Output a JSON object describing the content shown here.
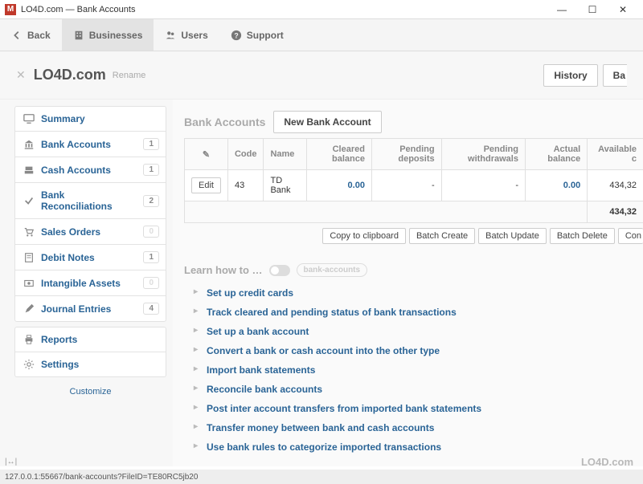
{
  "window": {
    "app_icon_letter": "M",
    "title": "LO4D.com — Bank Accounts"
  },
  "win_controls": {
    "min": "—",
    "max": "☐",
    "close": "✕"
  },
  "topnav": {
    "back": "Back",
    "businesses": "Businesses",
    "users": "Users",
    "support": "Support"
  },
  "business": {
    "name": "LO4D.com",
    "rename": "Rename",
    "history_btn": "History",
    "back_btn_partial": "Ba"
  },
  "sidebar": {
    "items": [
      {
        "label": "Summary",
        "icon": "monitor",
        "badge": null
      },
      {
        "label": "Bank Accounts",
        "icon": "bank",
        "badge": "1"
      },
      {
        "label": "Cash Accounts",
        "icon": "cash",
        "badge": "1"
      },
      {
        "label": "Bank Reconciliations",
        "icon": "check",
        "badge": "2"
      },
      {
        "label": "Sales Orders",
        "icon": "cart",
        "badge": "0"
      },
      {
        "label": "Debit Notes",
        "icon": "note",
        "badge": "1"
      },
      {
        "label": "Intangible Assets",
        "icon": "asset",
        "badge": "0"
      },
      {
        "label": "Journal Entries",
        "icon": "pen",
        "badge": "4"
      }
    ],
    "reports": "Reports",
    "settings": "Settings",
    "customize": "Customize"
  },
  "bank_section": {
    "title": "Bank Accounts",
    "new_btn": "New Bank Account",
    "columns": {
      "edit_col": "✎",
      "code": "Code",
      "name": "Name",
      "cleared": "Cleared balance",
      "pending_dep": "Pending deposits",
      "pending_wd": "Pending withdrawals",
      "actual": "Actual balance",
      "available": "Available c"
    },
    "rows": [
      {
        "edit": "Edit",
        "code": "43",
        "name": "TD Bank",
        "cleared": "0.00",
        "pending_dep": "-",
        "pending_wd": "-",
        "actual": "0.00",
        "available": "434,32"
      }
    ],
    "footer_available": "434,32",
    "actions": {
      "copy": "Copy to clipboard",
      "batch_create": "Batch Create",
      "batch_update": "Batch Update",
      "batch_delete": "Batch Delete",
      "con": "Con"
    }
  },
  "learn": {
    "heading": "Learn how to …",
    "tag": "bank-accounts",
    "links": [
      "Set up credit cards",
      "Track cleared and pending status of bank transactions",
      "Set up a bank account",
      "Convert a bank or cash account into the other type",
      "Import bank statements",
      "Reconcile bank accounts",
      "Post inter account transfers from imported bank statements",
      "Transfer money between bank and cash accounts",
      "Use bank rules to categorize imported transactions"
    ]
  },
  "statusbar": {
    "url": "127.0.0.1:55667/bank-accounts?FileID=TE80RC5jb20"
  },
  "watermark": "LO4D.com",
  "expand_glyph": "|↔|"
}
